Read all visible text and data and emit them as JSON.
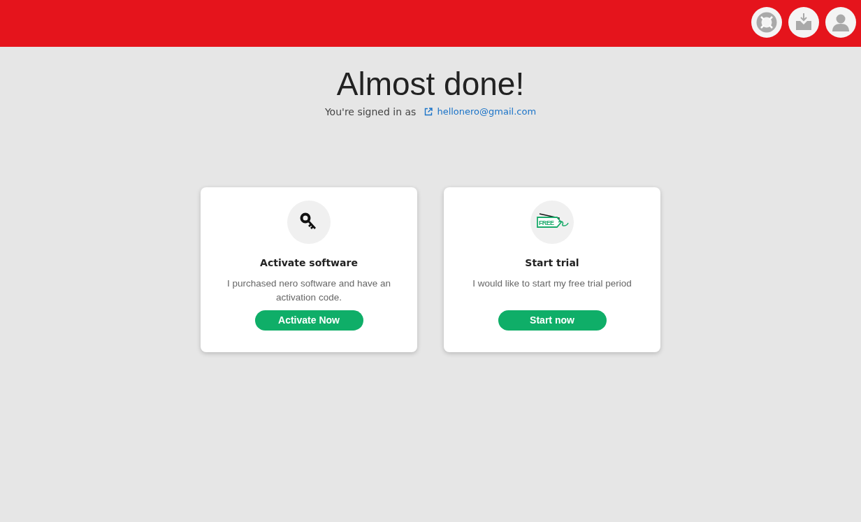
{
  "header": {
    "buttons": [
      {
        "kind": "support"
      },
      {
        "kind": "download"
      },
      {
        "kind": "account"
      }
    ]
  },
  "title": "Almost done!",
  "signed_in": {
    "label": "You're signed in as",
    "email": "hellonero@gmail.com"
  },
  "cards": [
    {
      "kind": "key",
      "title": "Activate software",
      "text": "I purchased nero software and have an activation code.",
      "button": "Activate Now"
    },
    {
      "kind": "tag",
      "icon_text": "FREE",
      "title": "Start trial",
      "text": "I would like to start my free trial period",
      "button": "Start now"
    }
  ]
}
